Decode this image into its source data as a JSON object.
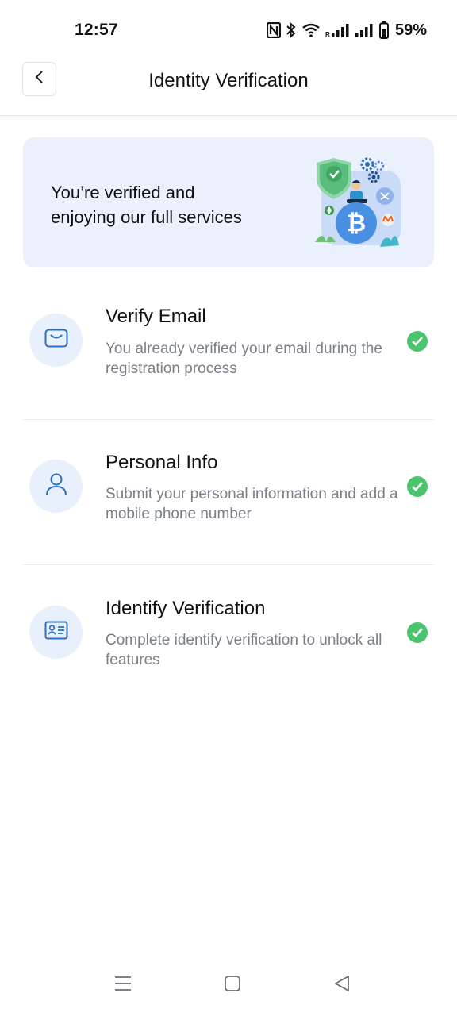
{
  "status_bar": {
    "time": "12:57",
    "battery_percent": "59%",
    "icons": [
      "nfc-icon",
      "bluetooth-icon",
      "wifi-icon",
      "signal-icon",
      "signal-icon",
      "battery-icon"
    ]
  },
  "header": {
    "title": "Identity Verification",
    "back_icon": "chevron-left-icon"
  },
  "banner": {
    "line1": "You’re verified and",
    "line2": "enjoying our full services",
    "illustration": "crypto-verification-illustration"
  },
  "items": [
    {
      "title": "Verify Email",
      "description": "You already verified your email during the registration process",
      "icon": "envelope-icon",
      "status_icon": "check-circle-icon"
    },
    {
      "title": "Personal Info",
      "description": "Submit your personal information and add a mobile phone number",
      "icon": "user-icon",
      "status_icon": "check-circle-icon"
    },
    {
      "title": "Identify Verification",
      "description": "Complete identify verification to unlock all features",
      "icon": "id-card-icon",
      "status_icon": "check-circle-icon"
    }
  ],
  "nav_bar": {
    "icons": [
      "menu-icon",
      "home-square-icon",
      "back-triangle-icon"
    ]
  },
  "colors": {
    "accent": "#2d6fbf",
    "banner_bg": "#eaf1fd",
    "icon_bg": "#e8f0fc",
    "success": "#4cc46d",
    "secondary_text": "#7a7f87"
  }
}
